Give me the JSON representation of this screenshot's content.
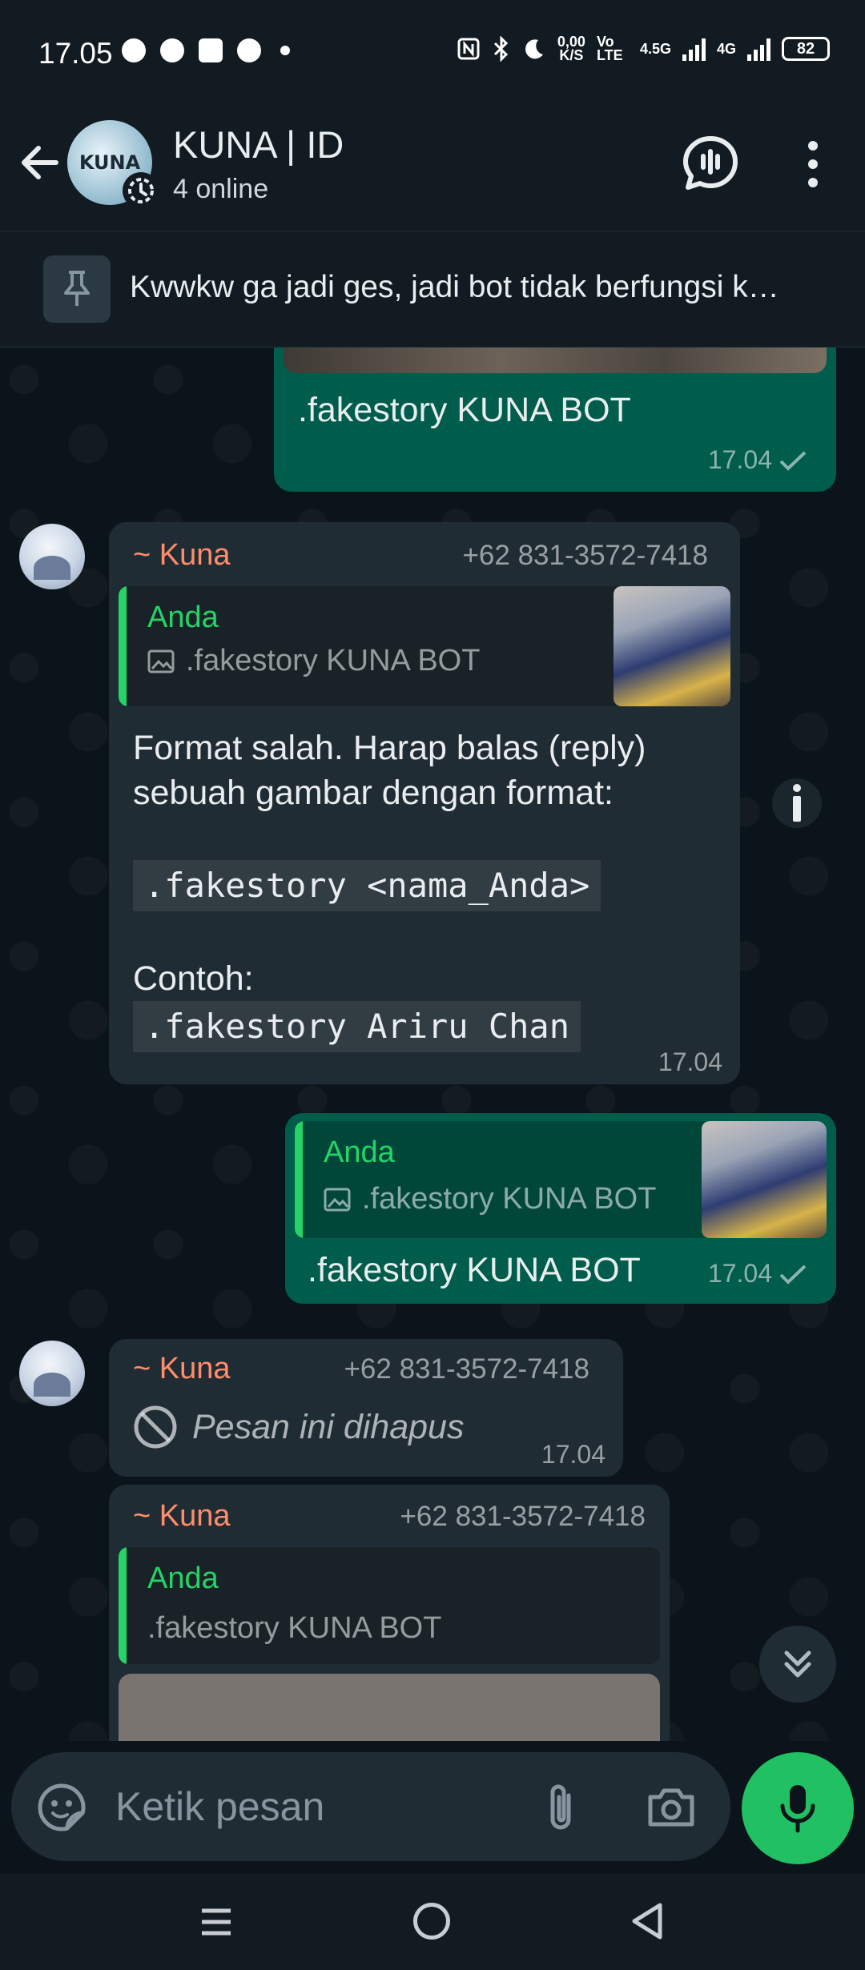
{
  "status_bar": {
    "time": "17.05",
    "net_speed_top": "0,00",
    "net_speed_bottom": "K/S",
    "volte": "Vo LTE",
    "net1": "4.5G",
    "net2": "4G",
    "battery": "82"
  },
  "header": {
    "title": "KUNA | ID",
    "subtitle": "4 online",
    "avatar_text": "KUNA"
  },
  "pinned": {
    "text": "Kwwkw ga jadi ges, jadi bot tidak berfungsi k…"
  },
  "messages": {
    "m1": {
      "text": ".fakestory KUNA BOT",
      "time": "17.04"
    },
    "m2": {
      "sender": "~ Kuna",
      "phone": "+62 831-3572-7418",
      "quote_name": "Anda",
      "quote_text": ".fakestory KUNA BOT",
      "line1": "Format salah. Harap balas (reply)",
      "line2": "sebuah gambar dengan format:",
      "code1": ".fakestory <nama_Anda>",
      "line3": "Contoh:",
      "code2": ".fakestory Ariru Chan",
      "time": "17.04"
    },
    "m3": {
      "quote_name": "Anda",
      "quote_text": ".fakestory KUNA BOT",
      "text": ".fakestory KUNA BOT",
      "time": "17.04"
    },
    "m4": {
      "sender": "~ Kuna",
      "phone": "+62 831-3572-7418",
      "text": "Pesan ini dihapus",
      "time": "17.04"
    },
    "m5": {
      "sender": "~ Kuna",
      "phone": "+62 831-3572-7418",
      "quote_name": "Anda",
      "quote_text": ".fakestory KUNA BOT"
    }
  },
  "input": {
    "placeholder": "Ketik pesan"
  },
  "icons": {
    "back": "arrow-left-icon",
    "call": "voice-chat-icon",
    "more": "more-vertical-icon",
    "pin": "pin-icon",
    "emoji": "sticker-icon",
    "attach": "paperclip-icon",
    "camera": "camera-icon",
    "mic": "mic-icon"
  },
  "colors": {
    "outgoing_bubble": "#005c4b",
    "incoming_bubble": "#202c33",
    "accent_green": "#21c063",
    "sender_color": "#ff8c6b"
  }
}
